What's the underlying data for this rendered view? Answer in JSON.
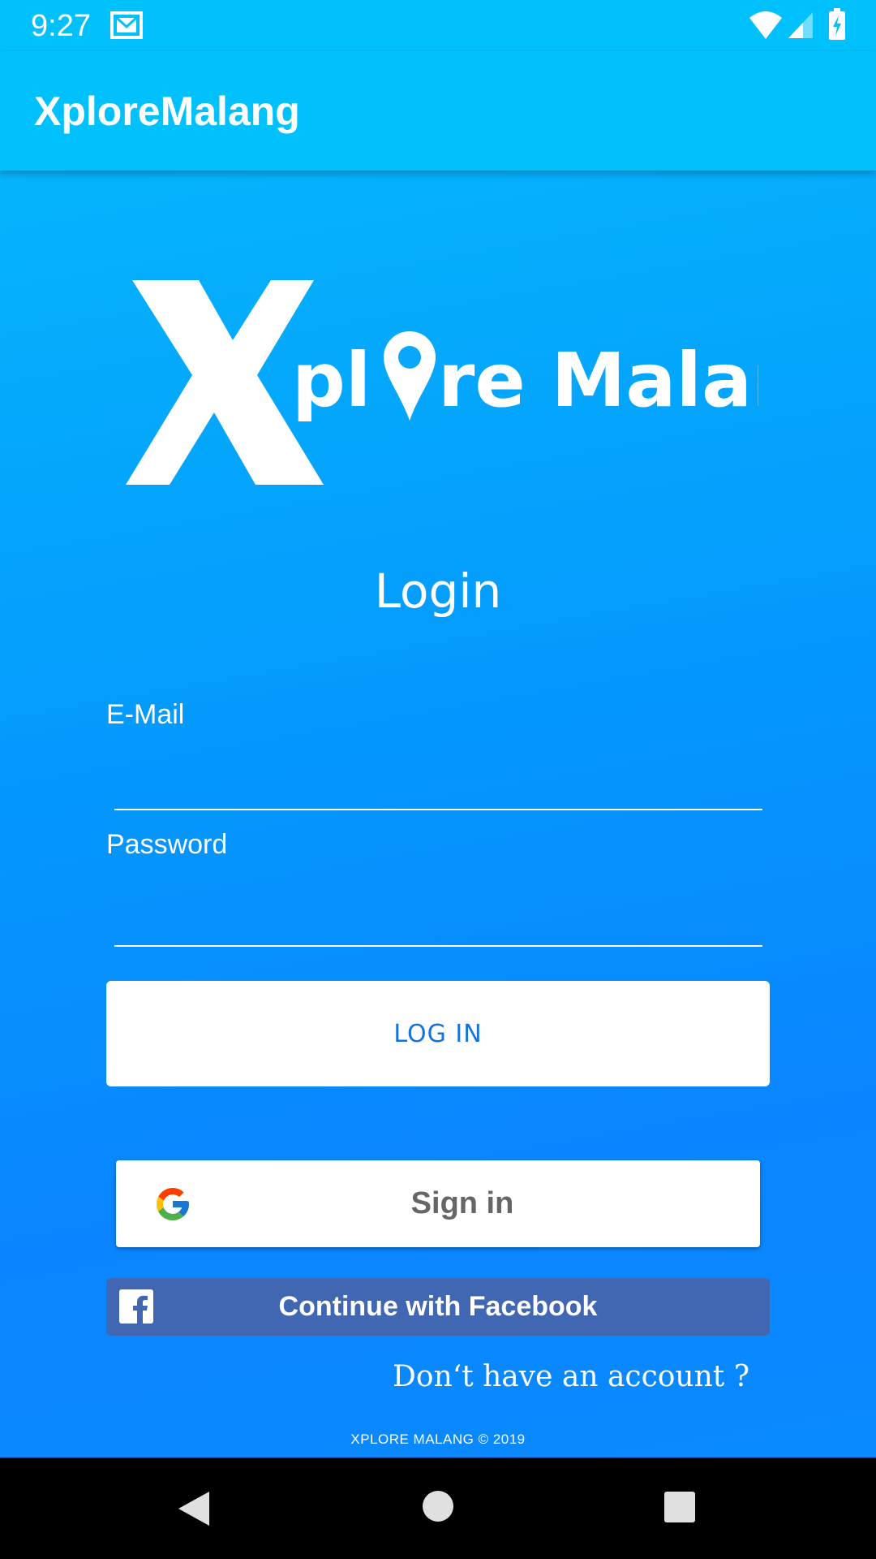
{
  "status_bar": {
    "time": "9:27",
    "icons": [
      "mail-icon",
      "wifi-icon",
      "signal-icon",
      "battery-charging-icon"
    ]
  },
  "app_bar": {
    "title": "XploreMalang"
  },
  "logo": {
    "text": "Xplore Malang"
  },
  "login": {
    "heading": "Login",
    "email_label": "E-Mail",
    "email_value": "",
    "password_label": "Password",
    "password_value": "",
    "login_button": "LOG IN"
  },
  "google_button": {
    "label": "Sign in",
    "icon": "google-icon"
  },
  "facebook_button": {
    "label": "Continue with Facebook",
    "icon": "facebook-icon"
  },
  "signup_link": "Don‘t have an account ?",
  "footer": "XPLORE MALANG © 2019",
  "nav_bar": {
    "icons": [
      "back-icon",
      "home-icon",
      "recents-icon"
    ]
  },
  "colors": {
    "status_bar": "#00c1fc",
    "app_bar": "#00c1fc",
    "gradient_top": "#05b4fc",
    "gradient_bottom": "#0a8aff",
    "login_text": "#1273de",
    "facebook": "#4267b2"
  }
}
